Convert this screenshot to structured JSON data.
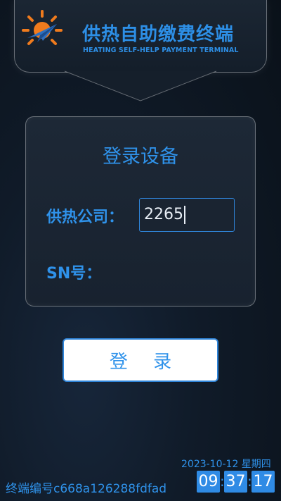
{
  "header": {
    "title": "供热自助缴费终端",
    "subtitle": "HEATING SELF-HELP PAYMENT TERMINAL",
    "logo_icon": "sun-paper-plane-logo"
  },
  "login_panel": {
    "title": "登录设备",
    "company_label": "供热公司：",
    "company_value": "2265",
    "sn_label": "SN号："
  },
  "login_button": {
    "label": "登 录"
  },
  "footer": {
    "terminal_id": "终端编号c668a126288fdfad",
    "date": "2023-10-12 星期四",
    "clock": {
      "hours": "09",
      "minutes": "37",
      "seconds": "17"
    }
  },
  "colors": {
    "accent": "#2f92ea",
    "logo_orange": "#f07b1d",
    "background": "#101b29"
  }
}
